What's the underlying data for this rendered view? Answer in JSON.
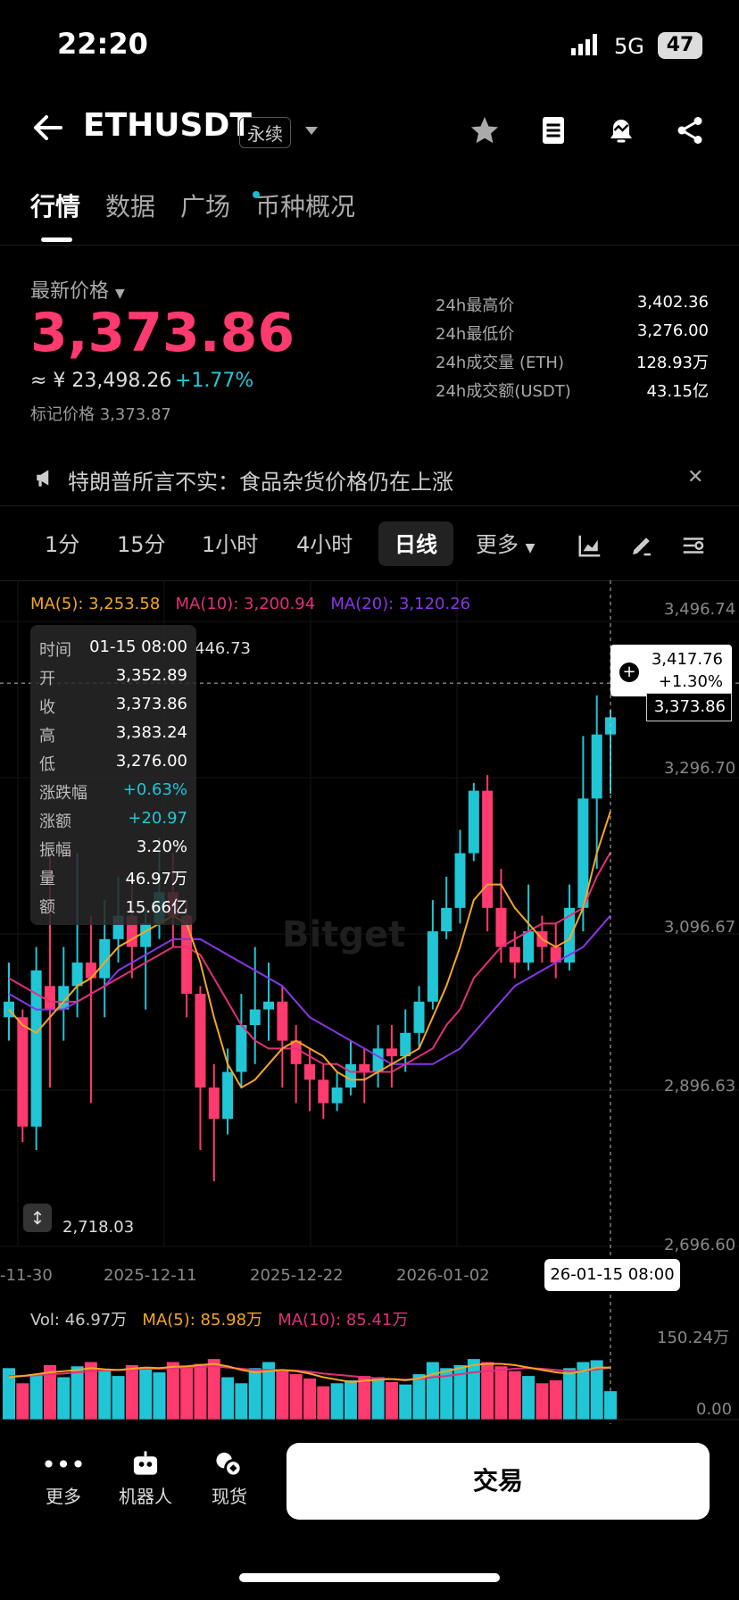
{
  "status": {
    "time": "22:20",
    "network": "5G",
    "battery": "47"
  },
  "header": {
    "symbol": "ETHUSDT",
    "contract_tag": "永续"
  },
  "tabs": [
    "行情",
    "数据",
    "广场",
    "币种概况"
  ],
  "price": {
    "label": "最新价格",
    "last": "3,373.86",
    "cny": "≈ ¥ 23,498.26",
    "change": "+1.77%",
    "mark": "标记价格 3,373.87"
  },
  "stats": [
    {
      "k": "24h最高价",
      "v": "3,402.36"
    },
    {
      "k": "24h最低价",
      "v": "3,276.00"
    },
    {
      "k": "24h成交量 (ETH)",
      "v": "128.93万"
    },
    {
      "k": "24h成交额(USDT)",
      "v": "43.15亿"
    }
  ],
  "news": "特朗普所言不实：食品杂货价格仍在上涨",
  "intervals": [
    "1分",
    "15分",
    "1小时",
    "4小时",
    "日线",
    "更多"
  ],
  "ma": {
    "ma5": "MA(5): 3,253.58",
    "ma10": "MA(10): 3,200.94",
    "ma20": "MA(20): 3,120.26"
  },
  "axis": {
    "y": [
      "3,496.74",
      "3,296.70",
      "3,096.67",
      "2,896.63",
      "2,696.60"
    ],
    "x": [
      "-11-30",
      "2025-12-11",
      "2025-12-22",
      "2026-01-02"
    ],
    "vol": [
      "150.24万",
      "0.00"
    ]
  },
  "tooltip": [
    {
      "k": "时间",
      "v": "01-15 08:00"
    },
    {
      "k": "开",
      "v": "3,352.89"
    },
    {
      "k": "收",
      "v": "3,373.86"
    },
    {
      "k": "高",
      "v": "3,383.24"
    },
    {
      "k": "低",
      "v": "3,276.00"
    },
    {
      "k": "涨跌幅",
      "v": "+0.63%"
    },
    {
      "k": "涨额",
      "v": "+20.97"
    },
    {
      "k": "振幅",
      "v": "3.20%"
    },
    {
      "k": "量",
      "v": "46.97万"
    },
    {
      "k": "额",
      "v": "15.66亿"
    }
  ],
  "high_label_partial": "446.73",
  "crosshair": {
    "price": "3,417.76",
    "pct": "+1.30%",
    "last": "3,373.86",
    "date": "26-01-15 08:00"
  },
  "low_label": "2,718.03",
  "volume": {
    "vol": "Vol: 46.97万",
    "ma5": "MA(5): 85.98万",
    "ma10": "MA(10): 85.41万"
  },
  "watermark": "Bitget",
  "nav": {
    "more": "更多",
    "robot": "机器人",
    "spot": "现货",
    "trade": "交易"
  },
  "colors": {
    "up": "#21c6d6",
    "down": "#ff3a6e",
    "ma5": "#f5a623",
    "ma10": "#e0307a",
    "ma20": "#8a35e8"
  },
  "chart_data": {
    "type": "candlestick",
    "ylim": [
      2696.6,
      3496.74
    ],
    "x_ticks": [
      "-11-30",
      "2025-12-11",
      "2025-12-22",
      "2026-01-02"
    ],
    "candles": [
      [
        2990,
        3010,
        3060,
        2960
      ],
      [
        2990,
        2850,
        3000,
        2830
      ],
      [
        2850,
        3050,
        3080,
        2820
      ],
      [
        3030,
        3000,
        3200,
        2900
      ],
      [
        3000,
        3030,
        3080,
        2960
      ],
      [
        3030,
        3060,
        3200,
        2990
      ],
      [
        3060,
        3040,
        3120,
        2880
      ],
      [
        3040,
        3090,
        3140,
        2990
      ],
      [
        3090,
        3120,
        3170,
        3060
      ],
      [
        3120,
        3080,
        3160,
        3040
      ],
      [
        3080,
        3110,
        3130,
        3000
      ],
      [
        3110,
        3150,
        3220,
        3090
      ],
      [
        3150,
        3120,
        3200,
        3080
      ],
      [
        3120,
        3020,
        3140,
        2990
      ],
      [
        3020,
        2900,
        3030,
        2820
      ],
      [
        2900,
        2860,
        2930,
        2780
      ],
      [
        2860,
        2920,
        2950,
        2840
      ],
      [
        2920,
        2980,
        3020,
        2900
      ],
      [
        2980,
        3000,
        3080,
        2930
      ],
      [
        3000,
        3010,
        3060,
        2960
      ],
      [
        3010,
        2960,
        3030,
        2900
      ],
      [
        2960,
        2930,
        2980,
        2880
      ],
      [
        2930,
        2910,
        2950,
        2870
      ],
      [
        2910,
        2880,
        2930,
        2860
      ],
      [
        2880,
        2900,
        2920,
        2870
      ],
      [
        2900,
        2930,
        2960,
        2890
      ],
      [
        2930,
        2920,
        2950,
        2880
      ],
      [
        2920,
        2950,
        2980,
        2900
      ],
      [
        2950,
        2940,
        2980,
        2900
      ],
      [
        2940,
        2970,
        3000,
        2920
      ],
      [
        2970,
        3010,
        3030,
        2950
      ],
      [
        3010,
        3100,
        3140,
        3000
      ],
      [
        3100,
        3130,
        3170,
        3090
      ],
      [
        3130,
        3200,
        3230,
        3110
      ],
      [
        3200,
        3280,
        3290,
        3190
      ],
      [
        3280,
        3130,
        3300,
        3100
      ],
      [
        3130,
        3080,
        3180,
        3060
      ],
      [
        3080,
        3060,
        3100,
        3040
      ],
      [
        3060,
        3100,
        3160,
        3050
      ],
      [
        3100,
        3080,
        3120,
        3060
      ],
      [
        3080,
        3060,
        3110,
        3040
      ],
      [
        3060,
        3130,
        3160,
        3050
      ],
      [
        3130,
        3270,
        3350,
        3100
      ],
      [
        3270,
        3352,
        3402,
        3180
      ],
      [
        3352,
        3374,
        3383,
        3276
      ]
    ],
    "ma5": [
      3000,
      2980,
      2970,
      2990,
      3010,
      3030,
      3040,
      3060,
      3080,
      3090,
      3100,
      3110,
      3120,
      3110,
      3060,
      2990,
      2930,
      2900,
      2910,
      2930,
      2950,
      2960,
      2950,
      2940,
      2920,
      2910,
      2910,
      2920,
      2930,
      2940,
      2950,
      2990,
      3030,
      3080,
      3140,
      3160,
      3160,
      3130,
      3110,
      3090,
      3080,
      3090,
      3130,
      3200,
      3253.58
    ],
    "ma10": [
      3040,
      3030,
      3020,
      3010,
      3010,
      3010,
      3020,
      3030,
      3040,
      3050,
      3060,
      3070,
      3080,
      3080,
      3070,
      3040,
      3010,
      2980,
      2960,
      2950,
      2950,
      2950,
      2940,
      2930,
      2930,
      2920,
      2920,
      2920,
      2920,
      2930,
      2940,
      2950,
      2980,
      3000,
      3040,
      3060,
      3080,
      3090,
      3100,
      3110,
      3110,
      3120,
      3130,
      3170,
      3200.94
    ],
    "ma20": [
      3020,
      3010,
      3000,
      3000,
      3000,
      3010,
      3020,
      3030,
      3050,
      3060,
      3070,
      3080,
      3090,
      3090,
      3090,
      3080,
      3070,
      3060,
      3050,
      3040,
      3030,
      3010,
      2990,
      2980,
      2970,
      2960,
      2950,
      2940,
      2930,
      2930,
      2930,
      2930,
      2940,
      2950,
      2970,
      2990,
      3010,
      3030,
      3040,
      3050,
      3060,
      3070,
      3080,
      3100,
      3120.26
    ],
    "volume_max": 150.24,
    "volume": [
      85,
      60,
      75,
      90,
      70,
      88,
      95,
      80,
      72,
      90,
      85,
      78,
      95,
      88,
      92,
      100,
      70,
      60,
      85,
      95,
      80,
      75,
      68,
      55,
      60,
      65,
      72,
      70,
      62,
      58,
      75,
      95,
      85,
      90,
      100,
      95,
      88,
      80,
      72,
      60,
      65,
      85,
      95,
      98,
      46.97
    ],
    "vol_ma5": [
      70,
      72,
      75,
      78,
      80,
      82,
      85,
      83,
      82,
      84,
      86,
      85,
      87,
      88,
      90,
      92,
      88,
      82,
      78,
      80,
      82,
      80,
      76,
      70,
      66,
      62,
      64,
      66,
      67,
      65,
      68,
      75,
      80,
      85,
      90,
      92,
      92,
      90,
      86,
      82,
      78,
      76,
      80,
      86,
      85.98
    ],
    "vol_ma10": [
      72,
      72,
      73,
      75,
      76,
      78,
      80,
      81,
      82,
      83,
      84,
      84,
      85,
      86,
      87,
      88,
      86,
      84,
      82,
      82,
      82,
      81,
      79,
      76,
      74,
      72,
      70,
      68,
      67,
      66,
      67,
      70,
      72,
      75,
      78,
      80,
      82,
      84,
      85,
      84,
      82,
      80,
      80,
      83,
      85.41
    ]
  }
}
